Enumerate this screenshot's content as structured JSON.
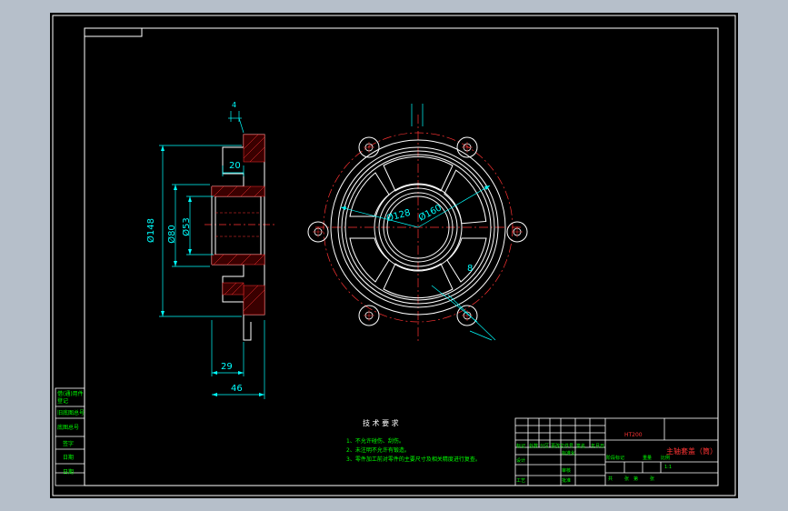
{
  "colors": {
    "background_outer": "#b6bfca",
    "canvas": "#000000",
    "outline": "#ffffff",
    "dimension": "#00ffff",
    "text": "#00ff00",
    "centerline": "#ff3333",
    "hatch": "#ff3333",
    "title_red": "#ff3333"
  },
  "side_view": {
    "dims": {
      "d148": "Ø148",
      "d80": "Ø80",
      "d53": "Ø53",
      "w20": "20",
      "w29": "29",
      "w46": "46",
      "w4": "4"
    }
  },
  "front_view": {
    "dims": {
      "d128": "Ø128",
      "d160": "Ø160",
      "w8": "8"
    }
  },
  "left_column": {
    "cells": [
      "借(通)用件登记",
      "旧底图总号",
      "底图总号",
      "签字",
      "日期",
      "日期"
    ]
  },
  "tech_requirements": {
    "title": "技 术 要 求",
    "items": [
      "1、不允许碰伤、刮伤。",
      "2、未注明不允许有锻造。",
      "3、零件加工前对零件的主要尺寸及相关精度进行复查。"
    ]
  },
  "title_block": {
    "material": "HT200",
    "part_name": "主轴套盖（筒）",
    "header_row": [
      "标记",
      "处数",
      "分区",
      "更改文件号",
      "签名",
      "年月日"
    ],
    "labels": [
      "设计",
      "标准化",
      "审核",
      "工艺",
      "批准"
    ],
    "stage": [
      "阶段标记",
      "重量",
      "比例"
    ],
    "scale": "1:1",
    "sheet": [
      "共",
      "张",
      "第",
      "张"
    ]
  }
}
